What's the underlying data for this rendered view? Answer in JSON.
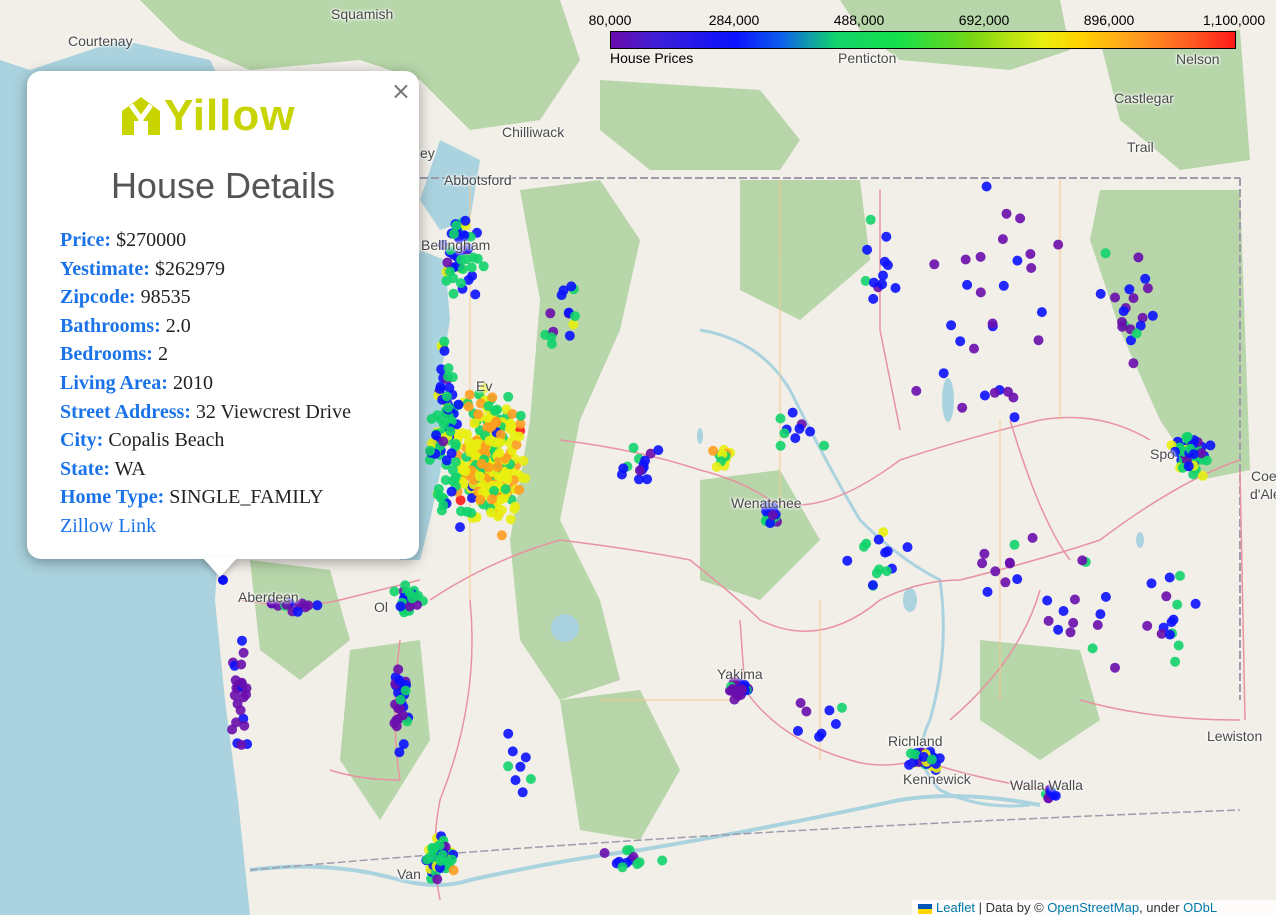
{
  "legend": {
    "ticks": [
      "80,000",
      "284,000",
      "488,000",
      "692,000",
      "896,000",
      "1,100,000"
    ],
    "caption": "House Prices",
    "colors": [
      "#6a0dad",
      "#0b12ff",
      "#12d36b",
      "#e8ee10",
      "#ff9d1f",
      "#ff1a1a"
    ]
  },
  "map": {
    "places": [
      "Squamish",
      "Courtenay",
      "Penticton",
      "Nelson",
      "Castlegar",
      "Chilliwack",
      "Trail",
      "Abbotsford",
      "Bellingham",
      "Ev",
      "Wenatchee",
      "Spo",
      "Coe",
      "d'Ale",
      "Aberdeen",
      "Ol",
      "Yakima",
      "Richland",
      "Kennewick",
      "Walla Walla",
      "Lewiston",
      "Van",
      "ey"
    ]
  },
  "popup": {
    "logo": "Yillow",
    "title": "House Details",
    "fields": [
      {
        "label": "Price:",
        "value": "$270000"
      },
      {
        "label": "Yestimate:",
        "value": "$262979"
      },
      {
        "label": "Zipcode:",
        "value": "98535"
      },
      {
        "label": "Bathrooms:",
        "value": "2.0"
      },
      {
        "label": "Bedrooms:",
        "value": "2"
      },
      {
        "label": "Living Area:",
        "value": "2010"
      },
      {
        "label": "Street Address:",
        "value": "32 Viewcrest Drive"
      },
      {
        "label": "City:",
        "value": "Copalis Beach"
      },
      {
        "label": "State:",
        "value": "WA"
      },
      {
        "label": "Home Type:",
        "value": "SINGLE_FAMILY"
      }
    ],
    "link": "Zillow Link",
    "close": "×"
  },
  "attribution": {
    "leaflet": "Leaflet",
    "sep": "| Data by ©",
    "osm": "OpenStreetMap",
    "under": ", under",
    "odbl": "ODbL"
  }
}
